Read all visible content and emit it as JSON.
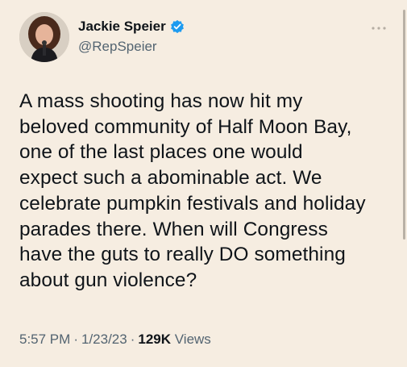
{
  "author": {
    "display_name": "Jackie Speier",
    "handle": "@RepSpeier",
    "verified_icon": "verified-badge-icon",
    "avatar_icon": "profile-photo"
  },
  "tweet": {
    "text_lines": [
      "A mass shooting has now hit my",
      "beloved community of Half Moon Bay,",
      "one of the last places one would",
      "expect such a abominable act. We",
      "celebrate pumpkin festivals and holiday",
      "parades there. When will Congress",
      "have the guts to really DO something",
      "about gun violence?"
    ],
    "time": "5:57 PM",
    "date": "1/23/23",
    "separator": "·",
    "views_count": "129K",
    "views_label": "Views"
  },
  "menu": {
    "icon": "more-options-icon"
  },
  "colors": {
    "background": "#f6ede1",
    "text_primary": "#0f1419",
    "text_secondary": "#536471",
    "verified_blue": "#1d9bf0"
  }
}
